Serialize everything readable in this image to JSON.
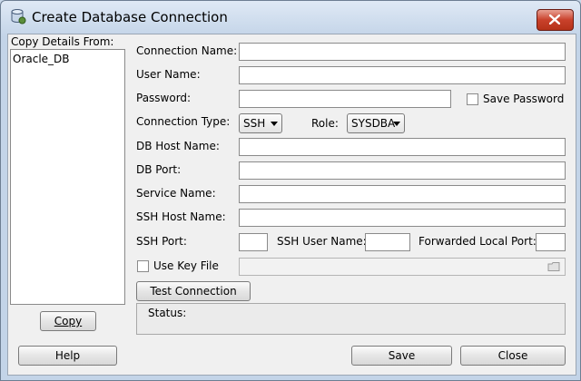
{
  "window": {
    "title": "Create Database Connection"
  },
  "copy_panel": {
    "label": "Copy Details From:",
    "items": [
      "Oracle_DB"
    ],
    "copy_button": "Copy"
  },
  "form": {
    "connection_name": {
      "label": "Connection Name:",
      "value": ""
    },
    "user_name": {
      "label": "User Name:",
      "value": ""
    },
    "password": {
      "label": "Password:",
      "value": ""
    },
    "save_password": {
      "label": "Save Password",
      "checked": false
    },
    "connection_type": {
      "label": "Connection Type:",
      "value": "SSH"
    },
    "role": {
      "label": "Role:",
      "value": "SYSDBA"
    },
    "db_host_name": {
      "label": "DB Host Name:",
      "value": ""
    },
    "db_port": {
      "label": "DB Port:",
      "value": ""
    },
    "service_name": {
      "label": "Service Name:",
      "value": ""
    },
    "ssh_host_name": {
      "label": "SSH Host Name:",
      "value": ""
    },
    "ssh_port": {
      "label": "SSH Port:",
      "value": ""
    },
    "ssh_user_name": {
      "label": "SSH User Name:",
      "value": ""
    },
    "forwarded_local_port": {
      "label": "Forwarded Local Port:",
      "value": ""
    },
    "use_key_file": {
      "label": "Use Key File",
      "checked": false,
      "value": ""
    },
    "test_connection_button": "Test Connection",
    "status_label": "Status:"
  },
  "footer": {
    "help_button": "Help",
    "save_button": "Save",
    "close_button": "Close"
  }
}
